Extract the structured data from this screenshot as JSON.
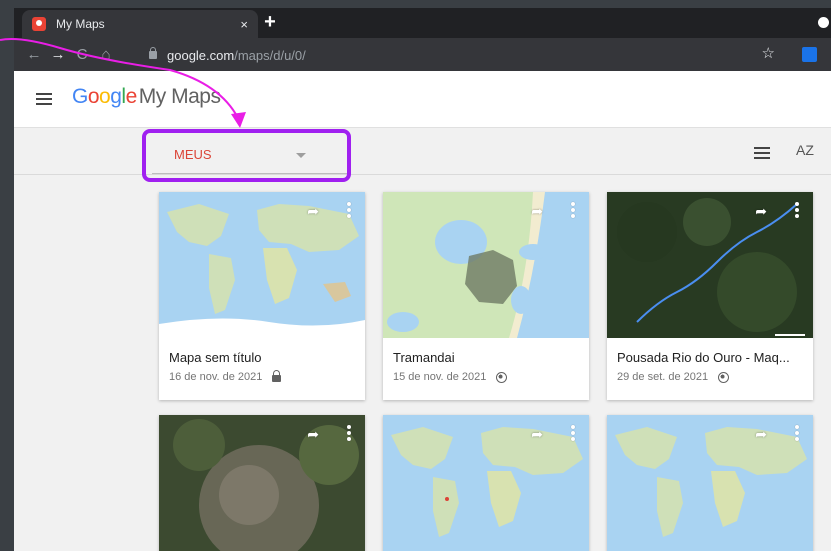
{
  "browser": {
    "tab_title": "My Maps",
    "tab_close": "×",
    "new_tab": "+",
    "url_host": "google.com",
    "url_path": "/maps/d/u/0/",
    "back": "←",
    "forward": "→",
    "reload": "C",
    "home": "⌂",
    "star": "☆"
  },
  "app": {
    "logo_letters": [
      "G",
      "o",
      "o",
      "g",
      "l",
      "e"
    ],
    "product": "My Maps"
  },
  "toolbar": {
    "filter_label": "MEUS",
    "sort_label": "AZ"
  },
  "colors": {
    "accent": "#db4437",
    "highlight": "#a020f0",
    "annotation": "#e91ee6"
  },
  "maps": [
    {
      "title": "Mapa sem título",
      "date": "16 de nov. de 2021",
      "visibility": "lock-icon",
      "thumb": "world"
    },
    {
      "title": "Tramandai",
      "date": "15 de nov. de 2021",
      "visibility": "globe-icon",
      "thumb": "coast"
    },
    {
      "title": "Pousada Rio do Ouro - Maq...",
      "date": "29 de set. de 2021",
      "visibility": "globe-icon",
      "thumb": "satellite"
    },
    {
      "title": "",
      "date": "",
      "visibility": "",
      "thumb": "satellite-city"
    },
    {
      "title": "",
      "date": "",
      "visibility": "",
      "thumb": "world"
    },
    {
      "title": "",
      "date": "",
      "visibility": "",
      "thumb": "world"
    }
  ]
}
